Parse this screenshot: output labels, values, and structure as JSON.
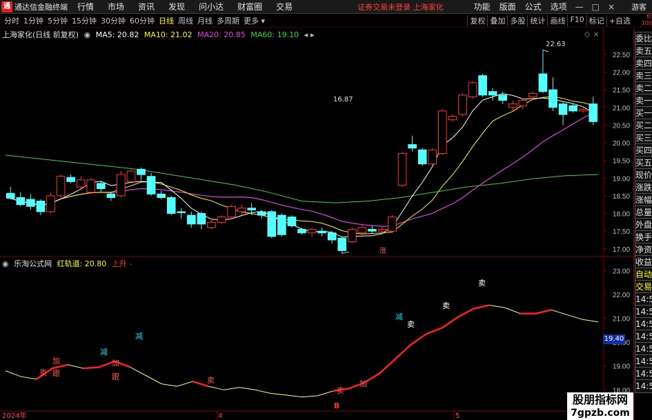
{
  "menubar": {
    "app_name": "通达信金融终端",
    "logo_char": "通",
    "items": [
      "行情",
      "市场",
      "资讯",
      "发现",
      "问小达",
      "财富圈",
      "交易"
    ],
    "notice": "证券交易未登录  上海家化",
    "right_items": [
      "功能",
      "版面",
      "公式",
      "选项"
    ],
    "window_buttons": [
      "—",
      "□",
      "×"
    ],
    "guest": "游客"
  },
  "periodbar": {
    "periods": [
      "分时",
      "1分钟",
      "5分钟",
      "15分钟",
      "30分钟",
      "60分钟",
      "日线",
      "周线",
      "月线",
      "多周期",
      "更多 ▾"
    ],
    "active_period": "日线",
    "tools": [
      "复权",
      "叠加",
      "多股",
      "统计",
      "画线",
      "F10",
      "标记",
      "+自选"
    ],
    "badge": "价\n100"
  },
  "main_chart": {
    "title": "上海家化(日线 前复权)",
    "ma_items": [
      {
        "label": "MA5: 20.82",
        "color": "#ffffff"
      },
      {
        "label": "MA10: 21.02",
        "color": "#ffff00"
      },
      {
        "label": "MA20: 20.85",
        "color": "#e040e0"
      },
      {
        "label": "MA60: 19.10",
        "color": "#40d040"
      }
    ],
    "price_axis": [
      "22.50",
      "22.00",
      "21.50",
      "21.00",
      "20.50",
      "20.00",
      "19.50",
      "19.00",
      "18.50",
      "18.00",
      "17.50",
      "17.00"
    ],
    "high_marker": "22.63",
    "low_marker": "16.87",
    "rise_marker": "涨"
  },
  "sub_chart": {
    "title": "乐淘公式网",
    "indicator": "红轨道: 20.80",
    "trend": "上升 -",
    "axis": [
      "23.00",
      "22.00",
      "21.00",
      "20.00",
      "19.00",
      "18.00"
    ],
    "current_value": "19.40",
    "b_marker": "B",
    "signals": {
      "mai": "卖",
      "jia": "加",
      "gen": "跟",
      "jian": "减"
    }
  },
  "date_axis": [
    "2024年",
    "4",
    "5"
  ],
  "right_panel": [
    "委比",
    "卖五",
    "卖四",
    "卖三",
    "卖二",
    "卖一",
    "买一",
    "买二",
    "买三",
    "买四",
    "买五",
    "现价",
    "涨跌",
    "涨幅",
    "总量",
    "外盘",
    "换手",
    "净资",
    "收益",
    "自动",
    "交易",
    "14:56",
    "14:56",
    "14:56",
    "14:56",
    "14:56",
    "14:56",
    "14:56",
    "14:56"
  ],
  "watermark": {
    "line1": "股朋指标网",
    "line2": "7gpzb.com"
  },
  "colors": {
    "up": "#ff3232",
    "down": "#54ffff",
    "ma5": "#ffffff",
    "ma10": "#ffff00",
    "ma20": "#e040e0",
    "ma60": "#40d040",
    "bg": "#000000",
    "grid": "#800000"
  },
  "chart_data": {
    "type": "candlestick",
    "title": "上海家化(日线 前复权)",
    "ylim": [
      16.8,
      22.85
    ],
    "candles": [
      {
        "o": 18.57,
        "c": 18.43,
        "h": 18.75,
        "l": 18.4
      },
      {
        "o": 18.45,
        "c": 18.25,
        "h": 18.6,
        "l": 18.2
      },
      {
        "o": 18.4,
        "c": 18.2,
        "h": 18.55,
        "l": 18.1
      },
      {
        "o": 18.35,
        "c": 18.05,
        "h": 18.4,
        "l": 17.95
      },
      {
        "o": 18.05,
        "c": 18.5,
        "h": 18.6,
        "l": 18.0
      },
      {
        "o": 18.5,
        "c": 19.05,
        "h": 19.1,
        "l": 18.45
      },
      {
        "o": 19.02,
        "c": 18.9,
        "h": 19.1,
        "l": 18.85
      },
      {
        "o": 18.75,
        "c": 18.95,
        "h": 19.05,
        "l": 18.65
      },
      {
        "o": 18.6,
        "c": 18.95,
        "h": 19.0,
        "l": 18.55
      },
      {
        "o": 18.85,
        "c": 18.7,
        "h": 18.9,
        "l": 18.6
      },
      {
        "o": 18.55,
        "c": 18.45,
        "h": 18.6,
        "l": 18.35
      },
      {
        "o": 18.5,
        "c": 19.1,
        "h": 19.2,
        "l": 18.45
      },
      {
        "o": 18.9,
        "c": 19.2,
        "h": 19.25,
        "l": 18.85
      },
      {
        "o": 19.25,
        "c": 19.1,
        "h": 19.3,
        "l": 18.95
      },
      {
        "o": 19.05,
        "c": 18.55,
        "h": 19.15,
        "l": 18.5
      },
      {
        "o": 18.55,
        "c": 18.45,
        "h": 18.65,
        "l": 18.4
      },
      {
        "o": 18.45,
        "c": 18.0,
        "h": 18.5,
        "l": 17.95
      },
      {
        "o": 18.05,
        "c": 18.03,
        "h": 18.15,
        "l": 17.85
      },
      {
        "o": 17.95,
        "c": 17.7,
        "h": 18.05,
        "l": 17.6
      },
      {
        "o": 18.0,
        "c": 17.7,
        "h": 18.05,
        "l": 17.55
      },
      {
        "o": 17.6,
        "c": 17.75,
        "h": 17.85,
        "l": 17.55
      },
      {
        "o": 17.75,
        "c": 17.9,
        "h": 17.95,
        "l": 17.7
      },
      {
        "o": 17.9,
        "c": 18.2,
        "h": 18.25,
        "l": 17.85
      },
      {
        "o": 18.05,
        "c": 18.15,
        "h": 18.25,
        "l": 17.95
      },
      {
        "o": 18.15,
        "c": 18.1,
        "h": 18.3,
        "l": 17.95
      },
      {
        "o": 18.05,
        "c": 17.95,
        "h": 18.1,
        "l": 17.85
      },
      {
        "o": 18.05,
        "c": 17.35,
        "h": 18.1,
        "l": 17.3
      },
      {
        "o": 17.95,
        "c": 17.4,
        "h": 18.0,
        "l": 17.35
      },
      {
        "o": 17.9,
        "c": 17.65,
        "h": 17.95,
        "l": 17.6
      },
      {
        "o": 17.55,
        "c": 17.45,
        "h": 17.6,
        "l": 17.4
      },
      {
        "o": 17.45,
        "c": 17.55,
        "h": 17.6,
        "l": 17.35
      },
      {
        "o": 17.5,
        "c": 17.45,
        "h": 17.6,
        "l": 17.35
      },
      {
        "o": 17.45,
        "c": 17.25,
        "h": 17.5,
        "l": 17.15
      },
      {
        "o": 17.3,
        "c": 16.95,
        "h": 17.35,
        "l": 16.87
      },
      {
        "o": 17.2,
        "c": 17.55,
        "h": 17.6,
        "l": 17.15
      },
      {
        "o": 17.45,
        "c": 17.6,
        "h": 17.7,
        "l": 17.35
      },
      {
        "o": 17.55,
        "c": 17.5,
        "h": 17.65,
        "l": 17.45
      },
      {
        "o": 17.5,
        "c": 17.55,
        "h": 17.65,
        "l": 17.45
      },
      {
        "o": 17.5,
        "c": 17.9,
        "h": 17.95,
        "l": 17.45
      },
      {
        "o": 18.8,
        "c": 19.7,
        "h": 19.75,
        "l": 18.75
      },
      {
        "o": 19.95,
        "c": 19.85,
        "h": 20.2,
        "l": 19.75
      },
      {
        "o": 19.8,
        "c": 19.4,
        "h": 19.85,
        "l": 19.35
      },
      {
        "o": 19.4,
        "c": 19.8,
        "h": 19.85,
        "l": 19.35
      },
      {
        "o": 19.7,
        "c": 20.9,
        "h": 20.95,
        "l": 19.65
      },
      {
        "o": 20.65,
        "c": 20.75,
        "h": 20.8,
        "l": 20.6
      },
      {
        "o": 20.8,
        "c": 21.35,
        "h": 21.4,
        "l": 20.75
      },
      {
        "o": 21.3,
        "c": 21.7,
        "h": 21.75,
        "l": 21.25
      },
      {
        "o": 21.9,
        "c": 21.35,
        "h": 21.95,
        "l": 21.3
      },
      {
        "o": 21.45,
        "c": 21.35,
        "h": 21.55,
        "l": 21.2
      },
      {
        "o": 21.35,
        "c": 21.2,
        "h": 21.45,
        "l": 21.1
      },
      {
        "o": 21.0,
        "c": 21.1,
        "h": 21.2,
        "l": 20.9
      },
      {
        "o": 21.05,
        "c": 21.2,
        "h": 21.25,
        "l": 20.95
      },
      {
        "o": 21.3,
        "c": 21.4,
        "h": 21.45,
        "l": 21.2
      },
      {
        "o": 21.95,
        "c": 21.45,
        "h": 22.63,
        "l": 21.4
      },
      {
        "o": 21.5,
        "c": 21.0,
        "h": 21.85,
        "l": 20.9
      },
      {
        "o": 21.1,
        "c": 20.8,
        "h": 21.15,
        "l": 20.5
      },
      {
        "o": 21.05,
        "c": 20.9,
        "h": 21.1,
        "l": 20.85
      },
      {
        "o": 20.9,
        "c": 20.95,
        "h": 21.0,
        "l": 20.85
      },
      {
        "o": 21.1,
        "c": 20.6,
        "h": 21.3,
        "l": 20.5
      }
    ],
    "ma60": [
      19.65,
      19.55,
      19.45,
      19.35,
      19.25,
      19.1,
      18.95,
      18.8,
      18.6,
      18.35,
      18.3,
      18.35,
      18.45,
      18.6,
      18.75,
      18.85,
      18.98,
      19.07,
      19.1
    ],
    "sub_series": [
      18.8,
      18.55,
      18.45,
      18.9,
      19.05,
      18.9,
      18.95,
      19.2,
      18.95,
      18.6,
      18.25,
      18.15,
      18.35,
      18.15,
      18.0,
      18.1,
      18.0,
      17.85,
      17.78,
      17.7,
      17.75,
      17.95,
      18.05,
      18.3,
      18.7,
      19.3,
      19.9,
      20.35,
      20.6,
      21.05,
      21.4,
      21.55,
      21.45,
      21.2,
      21.2,
      21.35,
      21.15,
      20.95,
      20.85
    ]
  }
}
